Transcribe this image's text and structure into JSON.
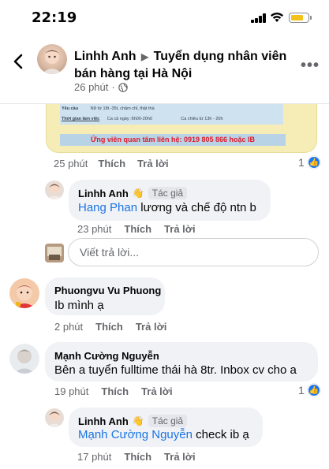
{
  "status_bar": {
    "time": "22:19",
    "battery_color": "#f3c21a"
  },
  "header": {
    "author": "Linhh Anh",
    "group": "Tuyển dụng nhân viên bán hàng tại Hà Nội",
    "time": "26 phút",
    "privacy_icon": "globe-icon"
  },
  "poster": {
    "requirement_label": "Yêu cầu",
    "requirement_text": "Nữ từ 18t -35t, chăm chỉ, thật thà",
    "hours_label": "Thời gian làm việc",
    "shift_morning": "Ca cả ngày :6h00-20h0",
    "shift_afternoon": "Ca chiều từ 13h - 20h",
    "cta": "Ứng viên quan tâm liên hệ: 0919 805 866 hoặc IB"
  },
  "post_actions": {
    "time": "25 phút",
    "like": "Thích",
    "reply": "Trả lời",
    "like_count": "1"
  },
  "comments": [
    {
      "author": "Linhh Anh",
      "badge": "Tác giả",
      "mention": "Hang Phan",
      "text": " lương và chế độ ntn b",
      "time": "23 phút",
      "like": "Thích",
      "reply": "Trả lời"
    },
    {
      "author": "Phuongvu Vu Phuong",
      "text": "Ib mình ạ",
      "time": "2 phút",
      "like": "Thích",
      "reply": "Trả lời"
    },
    {
      "author": "Mạnh Cường Nguyễn",
      "text": "Bên a tuyển fulltime thái hà 8tr. Inbox cv cho a",
      "time": "19 phút",
      "like": "Thích",
      "reply": "Trả lời",
      "like_count": "1"
    },
    {
      "author": "Linhh Anh",
      "badge": "Tác giả",
      "mention": "Mạnh Cường Nguyễn",
      "text": " check ib ạ",
      "time": "17 phút",
      "like": "Thích",
      "reply": "Trả lời"
    }
  ],
  "reply_input": {
    "placeholder": "Viết trả lời..."
  },
  "colors": {
    "link": "#1b74e4",
    "bubble": "#f0f2f5",
    "like": "#1877f2",
    "meta": "#65676b"
  }
}
